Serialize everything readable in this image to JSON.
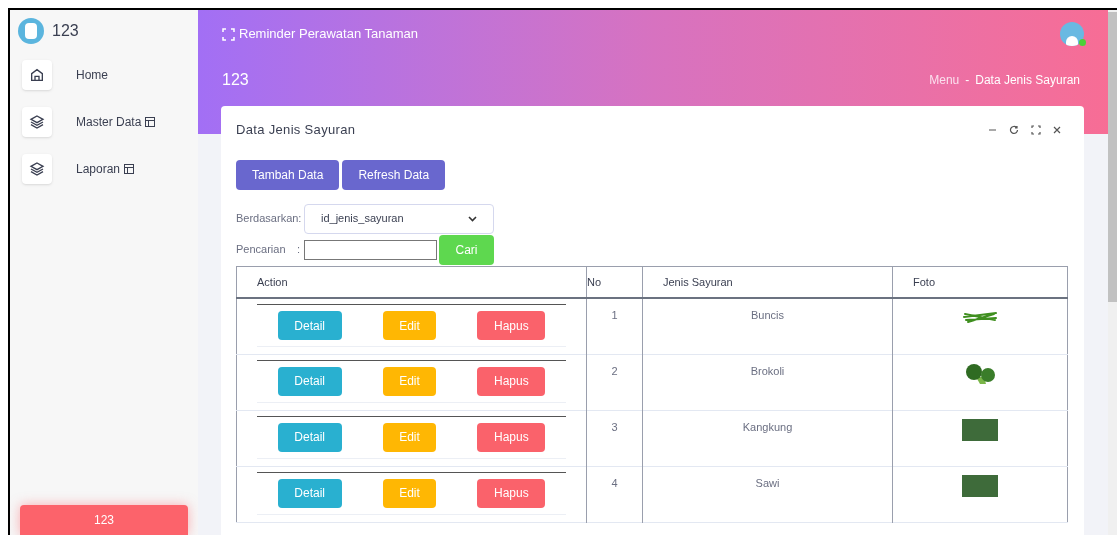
{
  "brand": {
    "title": "123"
  },
  "sidebar": {
    "items": [
      {
        "label": "Home",
        "kind": "home",
        "has_submenu": false
      },
      {
        "label": "Master Data",
        "kind": "layers",
        "has_submenu": true
      },
      {
        "label": "Laporan",
        "kind": "layers",
        "has_submenu": true
      }
    ],
    "footer_button": "123"
  },
  "header": {
    "app_title": "Reminder Perawatan Tanaman",
    "page_title": "123",
    "breadcrumb": [
      "Menu",
      "Data Jenis Sayuran"
    ],
    "breadcrumb_separator": "-",
    "user_online": true
  },
  "card": {
    "title": "Data Jenis Sayuran",
    "buttons": [
      "Tambah Data",
      "Refresh Data"
    ],
    "filter": {
      "label": "Berdasarkan:",
      "value": "id_jenis_sayuran"
    },
    "search": {
      "label": "Pencarian",
      "separator": ":",
      "button": "Cari"
    },
    "table": {
      "columns": [
        "Action",
        "No",
        "Jenis Sayuran",
        "Foto"
      ],
      "rows": [
        {
          "actions": [
            "Detail",
            "Edit",
            "Hapus"
          ],
          "no": "1",
          "name": "Buncis",
          "kind": "beans"
        },
        {
          "actions": [
            "Detail",
            "Edit",
            "Hapus"
          ],
          "no": "2",
          "name": "Brokoli",
          "kind": "broccoli"
        },
        {
          "actions": [
            "Detail",
            "Edit",
            "Hapus"
          ],
          "no": "3",
          "name": "Kangkung",
          "kind": "field"
        },
        {
          "actions": [
            "Detail",
            "Edit",
            "Hapus"
          ],
          "no": "4",
          "name": "Sawi",
          "kind": "field"
        }
      ]
    }
  }
}
